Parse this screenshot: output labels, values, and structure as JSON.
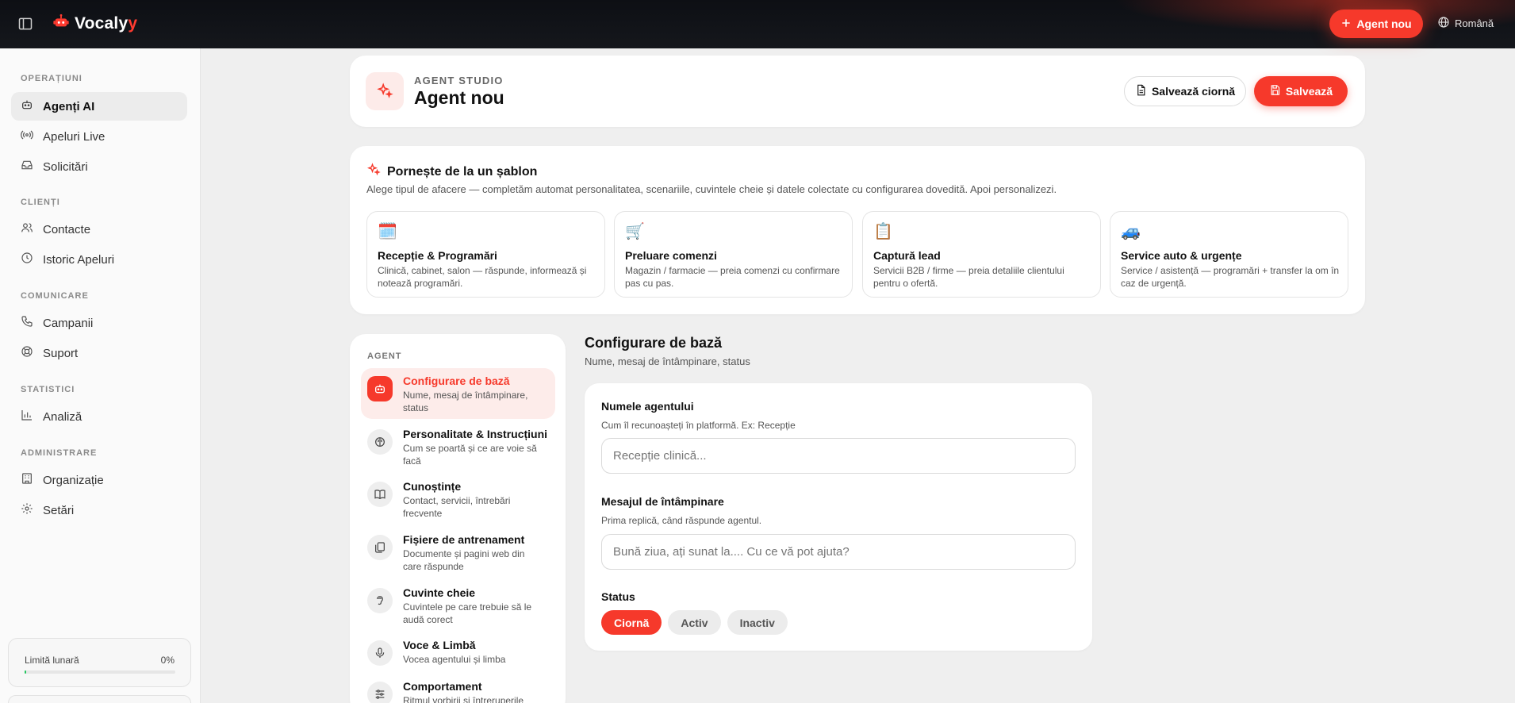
{
  "topbar": {
    "brand_main": "Vocaly",
    "brand_accent": "y",
    "new_agent_label": "Agent nou",
    "language": "Română"
  },
  "sidebar": {
    "sections": [
      {
        "title": "OPERAȚIUNI",
        "items": [
          {
            "label": "Agenți AI",
            "icon": "robot-icon",
            "active": true
          },
          {
            "label": "Apeluri Live",
            "icon": "broadcast-icon"
          },
          {
            "label": "Solicitări",
            "icon": "inbox-icon"
          }
        ]
      },
      {
        "title": "CLIENȚI",
        "items": [
          {
            "label": "Contacte",
            "icon": "users-icon"
          },
          {
            "label": "Istoric Apeluri",
            "icon": "clock-icon"
          }
        ]
      },
      {
        "title": "COMUNICARE",
        "items": [
          {
            "label": "Campanii",
            "icon": "phone-icon"
          },
          {
            "label": "Suport",
            "icon": "lifebuoy-icon"
          }
        ]
      },
      {
        "title": "STATISTICI",
        "items": [
          {
            "label": "Analiză",
            "icon": "bar-chart-icon"
          }
        ]
      },
      {
        "title": "ADMINISTRARE",
        "items": [
          {
            "label": "Organizație",
            "icon": "building-icon"
          },
          {
            "label": "Setări",
            "icon": "gear-icon"
          }
        ]
      }
    ],
    "limit": {
      "label": "Limită lunară",
      "value": "0%",
      "fraction": 0.0
    }
  },
  "header": {
    "kicker": "AGENT STUDIO",
    "title": "Agent nou",
    "draft_label": "Salvează ciornă",
    "save_label": "Salvează"
  },
  "templates": {
    "title": "Pornește de la un șablon",
    "description": "Alege tipul de afacere — completăm automat personalitatea, scenariile, cuvintele cheie și datele colectate cu configurarea dovedită. Apoi personalizezi.",
    "items": [
      {
        "emoji": "🗓️",
        "name": "Recepție & Programări",
        "text": "Clinică, cabinet, salon — răspunde, informează și notează programări."
      },
      {
        "emoji": "🛒",
        "name": "Preluare comenzi",
        "text": "Magazin / farmacie — preia comenzi cu confirmare pas cu pas."
      },
      {
        "emoji": "📋",
        "name": "Captură lead",
        "text": "Servicii B2B / firme — preia detaliile clientului pentru o ofertă."
      },
      {
        "emoji": "🚙",
        "name": "Service auto & urgențe",
        "text": "Service / asistență — programări + transfer la om în caz de urgență."
      }
    ]
  },
  "agent_nav": {
    "title": "AGENT",
    "items": [
      {
        "name": "Configurare de bază",
        "desc": "Nume, mesaj de întâmpinare, status",
        "icon": "robot-icon",
        "active": true
      },
      {
        "name": "Personalitate & Instrucțiuni",
        "desc": "Cum se poartă și ce are voie să facă",
        "icon": "brain-icon"
      },
      {
        "name": "Cunoștințe",
        "desc": "Contact, servicii, întrebări frecvente",
        "icon": "book-icon"
      },
      {
        "name": "Fișiere de antrenament",
        "desc": "Documente și pagini web din care răspunde",
        "icon": "files-icon"
      },
      {
        "name": "Cuvinte cheie",
        "desc": "Cuvintele pe care trebuie să le audă corect",
        "icon": "ear-icon"
      },
      {
        "name": "Voce & Limbă",
        "desc": "Vocea agentului și limba",
        "icon": "mic-icon"
      },
      {
        "name": "Comportament",
        "desc": "Ritmul vorbirii și întreruperile",
        "icon": "sliders-icon"
      }
    ]
  },
  "form": {
    "title": "Configurare de bază",
    "subtitle": "Nume, mesaj de întâmpinare, status",
    "name_label": "Numele agentului",
    "name_help": "Cum îl recunoașteți în platformă. Ex: Recepție",
    "name_placeholder": "Recepție clinică...",
    "greeting_label": "Mesajul de întâmpinare",
    "greeting_help": "Prima replică, când răspunde agentul.",
    "greeting_placeholder": "Bună ziua, ați sunat la.... Cu ce vă pot ajuta?",
    "status_label": "Status",
    "status_options": [
      "Ciornă",
      "Activ",
      "Inactiv"
    ],
    "status_selected": "Ciornă"
  },
  "colors": {
    "accent": "#f6392b",
    "topbar": "#0d0f14"
  }
}
